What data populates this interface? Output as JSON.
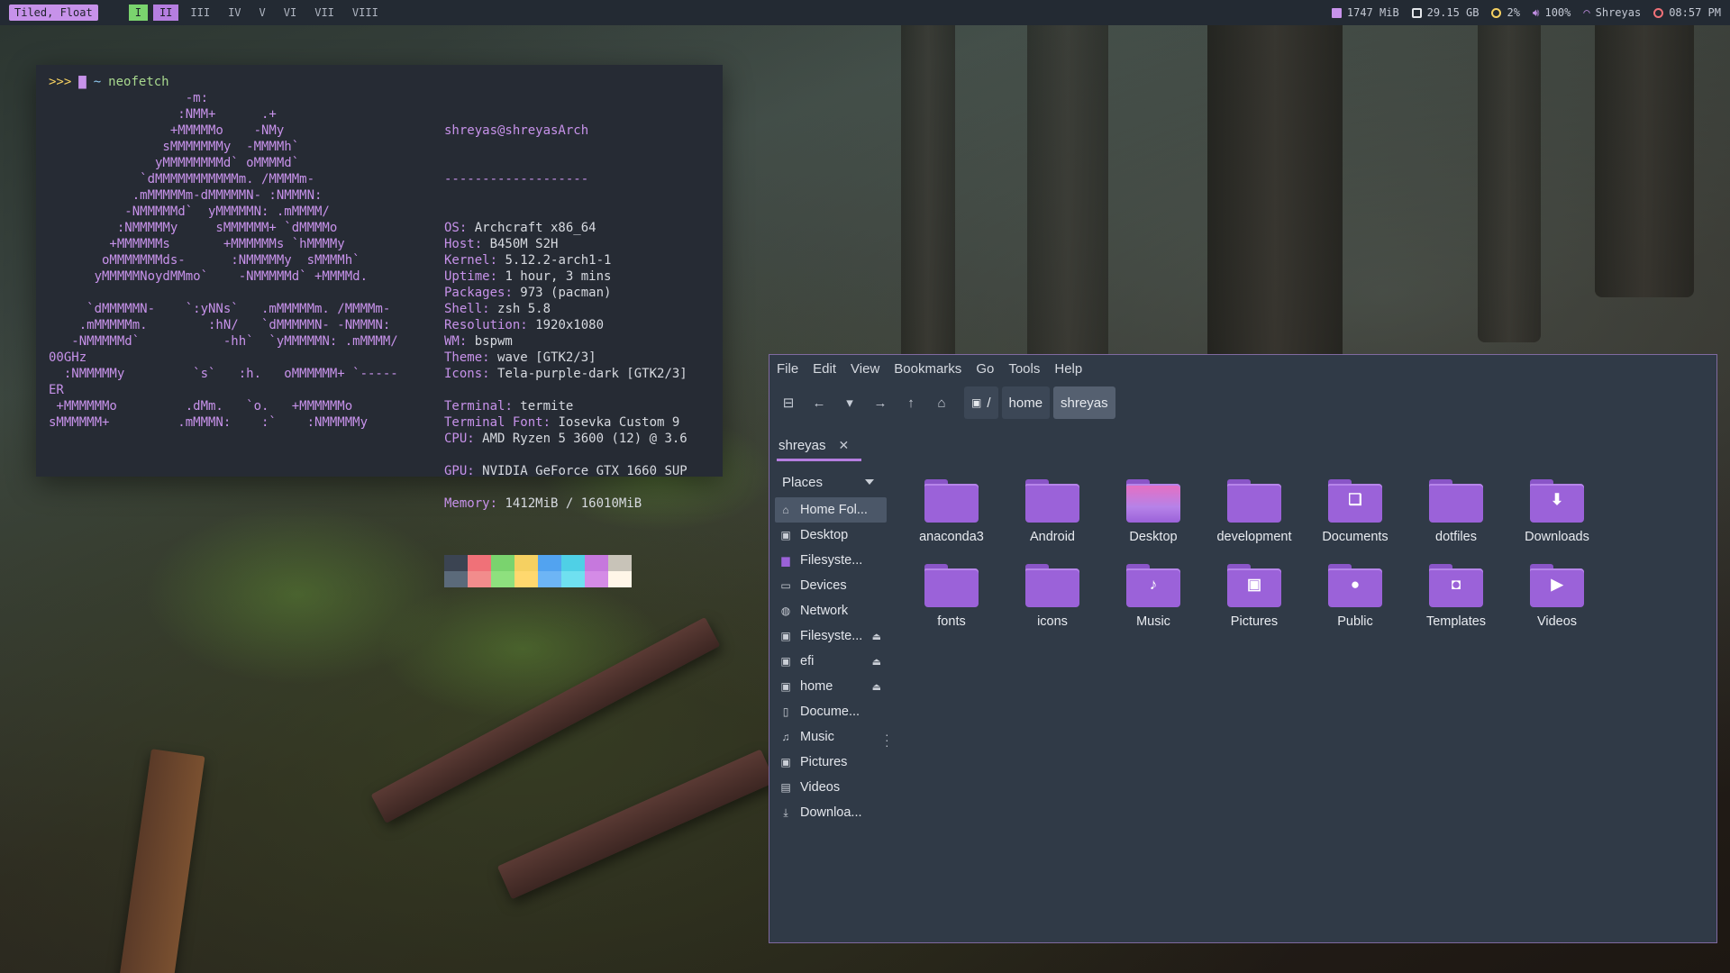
{
  "topbar": {
    "layout": "Tiled, Float",
    "workspaces": [
      "I",
      "II",
      "III",
      "IV",
      "V",
      "VI",
      "VII",
      "VIII"
    ],
    "memory": "1747 MiB",
    "disk": "29.15 GB",
    "cpu": "2%",
    "volume": "100%",
    "wifi": "Shreyas",
    "time": "08:57 PM"
  },
  "terminal": {
    "prompt_arrows": ">>>",
    "prompt_dir": "~",
    "command": "neofetch",
    "logo_lines": [
      "                  -m:",
      "                 :NMM+      .+",
      "                +MMMMMo    -NMy",
      "               sMMMMMMMy  -MMMMh`",
      "              yMMMMMMMMd` oMMMMd`",
      "            `dMMMMMMMMMMMm. /MMMMm-",
      "           .mMMMMMm-dMMMMMN- :NMMMN:",
      "          -NMMMMMd`  yMMMMMN: .mMMMM/",
      "         :NMMMMMy     sMMMMMM+ `dMMMMo",
      "        +MMMMMMs       +MMMMMMs `hMMMMy",
      "       oMMMMMMMds-      :NMMMMMy  sMMMMh`",
      "      yMMMMMNoydMMmo`    -NMMMMMd` +MMMMd.",
      "",
      "     `dMMMMMN-    `:yNNs`   .mMMMMMm. /MMMMm-",
      "    .mMMMMMm.        :hN/   `dMMMMMN- -NMMMN:",
      "   -NMMMMMd`           -hh`  `yMMMMMN: .mMMMM/",
      "00GHz",
      "  :NMMMMMy         `s`   :h.   oMMMMMM+ `-----",
      "ER",
      " +MMMMMMo         .dMm.   `o.   +MMMMMMo",
      "sMMMMMM+         .mMMMN:    :`    :NMMMMMy"
    ],
    "user_host": "shreyas@shreyasArch",
    "separator": "-------------------",
    "info": [
      {
        "key": "OS",
        "value": "Archcraft x86_64"
      },
      {
        "key": "Host",
        "value": "B450M S2H"
      },
      {
        "key": "Kernel",
        "value": "5.12.2-arch1-1"
      },
      {
        "key": "Uptime",
        "value": "1 hour, 3 mins"
      },
      {
        "key": "Packages",
        "value": "973 (pacman)"
      },
      {
        "key": "Shell",
        "value": "zsh 5.8"
      },
      {
        "key": "Resolution",
        "value": "1920x1080"
      },
      {
        "key": "WM",
        "value": "bspwm"
      },
      {
        "key": "Theme",
        "value": "wave [GTK2/3]"
      },
      {
        "key": "Icons",
        "value": "Tela-purple-dark [GTK2/3]"
      },
      {
        "key": "",
        "value": ""
      },
      {
        "key": "Terminal",
        "value": "termite"
      },
      {
        "key": "Terminal Font",
        "value": "Iosevka Custom 9"
      },
      {
        "key": "CPU",
        "value": "AMD Ryzen 5 3600 (12) @ 3.6"
      },
      {
        "key": "",
        "value": ""
      },
      {
        "key": "GPU",
        "value": "NVIDIA GeForce GTX 1660 SUP"
      },
      {
        "key": "",
        "value": ""
      },
      {
        "key": "Memory",
        "value": "1412MiB / 16010MiB"
      }
    ],
    "swatches_top": [
      "#3b4452",
      "#f07178",
      "#7ad36e",
      "#f5d061",
      "#52a3f0",
      "#4fd0e6",
      "#c678dd",
      "#c8c3b8"
    ],
    "swatches_bottom": [
      "#5b6a7a",
      "#f28c8c",
      "#8ee07e",
      "#ffd86e",
      "#6db5f5",
      "#6fe0f0",
      "#d48be6",
      "#fff6e8"
    ]
  },
  "filemanager": {
    "menu": [
      "File",
      "Edit",
      "View",
      "Bookmarks",
      "Go",
      "Tools",
      "Help"
    ],
    "breadcrumb": [
      "/",
      "home",
      "shreyas"
    ],
    "tab_label": "shreyas",
    "places_label": "Places",
    "sidebar": [
      {
        "label": "Home Fol...",
        "icon": "home-icon",
        "glyph": "⌂",
        "selected": true,
        "eject": false
      },
      {
        "label": "Desktop",
        "icon": "desktop-icon",
        "glyph": "▣",
        "selected": false,
        "eject": false
      },
      {
        "label": "Filesyste...",
        "icon": "folder-icon",
        "glyph": "▆",
        "selected": false,
        "eject": false
      },
      {
        "label": "Devices",
        "icon": "monitor-icon",
        "glyph": "▭",
        "selected": false,
        "eject": false
      },
      {
        "label": "Network",
        "icon": "globe-icon",
        "glyph": "◍",
        "selected": false,
        "eject": false
      },
      {
        "label": "Filesyste...",
        "icon": "drive-icon",
        "glyph": "▣",
        "selected": false,
        "eject": true
      },
      {
        "label": "efi",
        "icon": "drive-icon",
        "glyph": "▣",
        "selected": false,
        "eject": true
      },
      {
        "label": "home",
        "icon": "drive-icon",
        "glyph": "▣",
        "selected": false,
        "eject": true
      },
      {
        "label": "Docume...",
        "icon": "document-icon",
        "glyph": "▯",
        "selected": false,
        "eject": false
      },
      {
        "label": "Music",
        "icon": "music-icon",
        "glyph": "♫",
        "selected": false,
        "eject": false
      },
      {
        "label": "Pictures",
        "icon": "picture-icon",
        "glyph": "▣",
        "selected": false,
        "eject": false
      },
      {
        "label": "Videos",
        "icon": "video-icon",
        "glyph": "▤",
        "selected": false,
        "eject": false
      },
      {
        "label": "Downloa...",
        "icon": "download-icon",
        "glyph": "⤓",
        "selected": false,
        "eject": false
      }
    ],
    "items": [
      {
        "name": "anaconda3",
        "glyph": "",
        "type": "plain"
      },
      {
        "name": "Android",
        "glyph": "",
        "type": "plain"
      },
      {
        "name": "Desktop",
        "glyph": "",
        "type": "desktop"
      },
      {
        "name": "development",
        "glyph": "",
        "type": "plain"
      },
      {
        "name": "Documents",
        "glyph": "❑",
        "type": "plain"
      },
      {
        "name": "dotfiles",
        "glyph": "",
        "type": "plain"
      },
      {
        "name": "Downloads",
        "glyph": "⬇",
        "type": "plain"
      },
      {
        "name": "fonts",
        "glyph": "",
        "type": "plain"
      },
      {
        "name": "icons",
        "glyph": "",
        "type": "plain"
      },
      {
        "name": "Music",
        "glyph": "♪",
        "type": "plain"
      },
      {
        "name": "Pictures",
        "glyph": "▣",
        "type": "plain"
      },
      {
        "name": "Public",
        "glyph": "●",
        "type": "plain"
      },
      {
        "name": "Templates",
        "glyph": "◘",
        "type": "plain"
      },
      {
        "name": "Videos",
        "glyph": "▶",
        "type": "plain"
      }
    ]
  }
}
